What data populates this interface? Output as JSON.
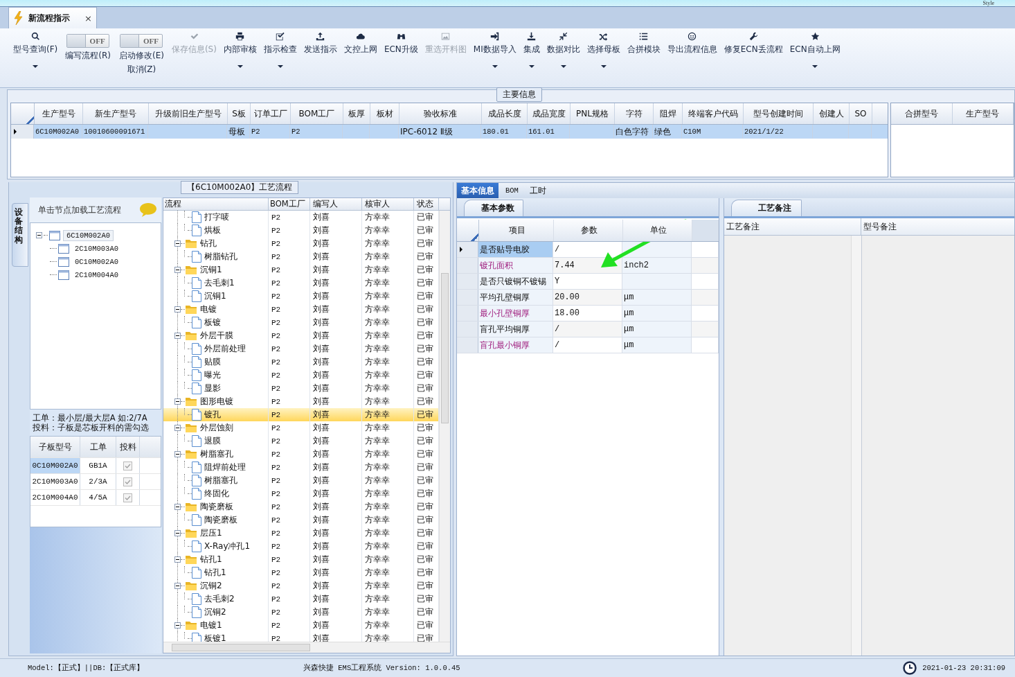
{
  "top_strip": {
    "style_menu": "Style"
  },
  "document_tab": {
    "title": "新流程指示",
    "close": "×",
    "selected": true
  },
  "toolbar": [
    {
      "kind": "button",
      "label": "型号查询(F)",
      "disabled": false,
      "dropdown": true
    },
    {
      "kind": "toggle",
      "label": "编写流程(R)",
      "switch_text": "OFF",
      "on": false
    },
    {
      "kind": "toggle",
      "label": "启动修改(E)",
      "label2": "取消(Z)",
      "switch_text": "OFF",
      "on": false
    },
    {
      "kind": "button",
      "label": "保存信息(S)",
      "disabled": true,
      "dropdown": false
    },
    {
      "kind": "button",
      "label": "内部审核",
      "disabled": false,
      "dropdown": true
    },
    {
      "kind": "button",
      "label": "指示检查",
      "disabled": false,
      "dropdown": true
    },
    {
      "kind": "button",
      "label": "发送指示",
      "disabled": false,
      "dropdown": false
    },
    {
      "kind": "button",
      "label": "文控上网",
      "disabled": false,
      "dropdown": false
    },
    {
      "kind": "button",
      "label": "ECN升级",
      "disabled": false,
      "dropdown": false
    },
    {
      "kind": "button",
      "label": "重选开料图",
      "disabled": true,
      "dropdown": false
    },
    {
      "kind": "button",
      "label": "MI数据导入",
      "disabled": false,
      "dropdown": true
    },
    {
      "kind": "button",
      "label": "集成",
      "disabled": false,
      "dropdown": true
    },
    {
      "kind": "button",
      "label": "数据对比",
      "disabled": false,
      "dropdown": true
    },
    {
      "kind": "button",
      "label": "选择母板",
      "disabled": false,
      "dropdown": true
    },
    {
      "kind": "button",
      "label": "合拼模块",
      "disabled": false,
      "dropdown": false
    },
    {
      "kind": "button",
      "label": "导出流程信息",
      "disabled": false,
      "dropdown": false
    },
    {
      "kind": "button",
      "label": "修复ECN丢流程",
      "disabled": false,
      "dropdown": false
    },
    {
      "kind": "button",
      "label": "ECN自动上网",
      "disabled": false,
      "dropdown": true
    }
  ],
  "main_info": {
    "title": "主要信息",
    "columns": [
      "生产型号",
      "新生产型号",
      "升级前旧生产型号",
      "S板",
      "订单工厂",
      "BOM工厂",
      "板厚",
      "板材",
      "验收标准",
      "成品长度",
      "成品宽度",
      "PNL规格",
      "字符",
      "阻焊",
      "终端客户代码",
      "型号创建时间",
      "创建人",
      "SO"
    ],
    "rows": [
      {
        "selected": true,
        "cells": [
          "6C10M002A0",
          "10010600091671",
          null,
          "母板",
          "P2",
          "P2",
          null,
          null,
          "IPC-6012 Ⅱ级",
          "180.01",
          "161.01",
          null,
          "白色字符",
          "绿色",
          "C10M",
          "2021/1/22",
          null,
          null
        ]
      }
    ],
    "side_columns": [
      "合拼型号",
      "生产型号"
    ]
  },
  "process": {
    "title": "【6C10M002A0】工艺流程",
    "vertical_tab": "设备结构",
    "board_tree": {
      "hint": "单击节点加载工艺流程",
      "nodes": [
        {
          "label": "6C10M002A0",
          "selected": true,
          "expanded": true,
          "children": [
            {
              "label": "2C10M003A0",
              "selected": false
            },
            {
              "label": "0C10M002A0",
              "selected": false
            },
            {
              "label": "2C10M004A0",
              "selected": false
            }
          ]
        }
      ]
    },
    "note_lines": [
      "工单：最小层/最大层A 如:2/7A",
      "投料：子板是芯板开料的需勾选"
    ],
    "sub_boards": {
      "columns": [
        "子板型号",
        "工单",
        "投料"
      ],
      "rows": [
        {
          "model": "0C10M002A0",
          "order": "GB1A",
          "feed": true,
          "selected": true
        },
        {
          "model": "2C10M003A0",
          "order": "2/3A",
          "feed": true,
          "selected": false
        },
        {
          "model": "2C10M004A0",
          "order": "4/5A",
          "feed": true,
          "selected": false
        }
      ]
    },
    "columns": [
      "流程",
      "BOM工厂",
      "编写人",
      "核审人",
      "状态"
    ],
    "nodes": [
      {
        "kind": "file",
        "name": "打字唛",
        "bom": "P2",
        "writer": "刘喜",
        "reviewer": "方幸幸",
        "status": "已审",
        "selected": false
      },
      {
        "kind": "file",
        "name": "烘板",
        "bom": "P2",
        "writer": "刘喜",
        "reviewer": "方幸幸",
        "status": "已审",
        "selected": false
      },
      {
        "kind": "folder",
        "name": "钻孔",
        "bom": "P2",
        "writer": "刘喜",
        "reviewer": "方幸幸",
        "status": "已审",
        "selected": false,
        "expanded": true,
        "children": [
          {
            "kind": "file",
            "name": "树脂钻孔",
            "bom": "P2",
            "writer": "刘喜",
            "reviewer": "方幸幸",
            "status": "已审",
            "selected": false
          }
        ]
      },
      {
        "kind": "folder",
        "name": "沉铜1",
        "bom": "P2",
        "writer": "刘喜",
        "reviewer": "方幸幸",
        "status": "已审",
        "selected": false,
        "expanded": true,
        "children": [
          {
            "kind": "file",
            "name": "去毛刺1",
            "bom": "P2",
            "writer": "刘喜",
            "reviewer": "方幸幸",
            "status": "已审",
            "selected": false
          },
          {
            "kind": "file",
            "name": "沉铜1",
            "bom": "P2",
            "writer": "刘喜",
            "reviewer": "方幸幸",
            "status": "已审",
            "selected": false
          }
        ]
      },
      {
        "kind": "folder",
        "name": "电镀",
        "bom": "P2",
        "writer": "刘喜",
        "reviewer": "方幸幸",
        "status": "已审",
        "selected": false,
        "expanded": true,
        "children": [
          {
            "kind": "file",
            "name": "板镀",
            "bom": "P2",
            "writer": "刘喜",
            "reviewer": "方幸幸",
            "status": "已审",
            "selected": false
          }
        ]
      },
      {
        "kind": "folder",
        "name": "外层干膜",
        "bom": "P2",
        "writer": "刘喜",
        "reviewer": "方幸幸",
        "status": "已审",
        "selected": false,
        "expanded": true,
        "children": [
          {
            "kind": "file",
            "name": "外层前处理",
            "bom": "P2",
            "writer": "刘喜",
            "reviewer": "方幸幸",
            "status": "已审",
            "selected": false
          },
          {
            "kind": "file",
            "name": "贴膜",
            "bom": "P2",
            "writer": "刘喜",
            "reviewer": "方幸幸",
            "status": "已审",
            "selected": false
          },
          {
            "kind": "file",
            "name": "曝光",
            "bom": "P2",
            "writer": "刘喜",
            "reviewer": "方幸幸",
            "status": "已审",
            "selected": false
          },
          {
            "kind": "file",
            "name": "显影",
            "bom": "P2",
            "writer": "刘喜",
            "reviewer": "方幸幸",
            "status": "已审",
            "selected": false
          }
        ]
      },
      {
        "kind": "folder",
        "name": "图形电镀",
        "bom": "P2",
        "writer": "刘喜",
        "reviewer": "方幸幸",
        "status": "已审",
        "selected": false,
        "expanded": true,
        "children": [
          {
            "kind": "file",
            "name": "镀孔",
            "bom": "P2",
            "writer": "刘喜",
            "reviewer": "方幸幸",
            "status": "已审",
            "selected": true
          }
        ]
      },
      {
        "kind": "folder",
        "name": "外层蚀刻",
        "bom": "P2",
        "writer": "刘喜",
        "reviewer": "方幸幸",
        "status": "已审",
        "selected": false,
        "expanded": true,
        "children": [
          {
            "kind": "file",
            "name": "退膜",
            "bom": "P2",
            "writer": "刘喜",
            "reviewer": "方幸幸",
            "status": "已审",
            "selected": false
          }
        ]
      },
      {
        "kind": "folder",
        "name": "树脂塞孔",
        "bom": "P2",
        "writer": "刘喜",
        "reviewer": "方幸幸",
        "status": "已审",
        "selected": false,
        "expanded": true,
        "children": [
          {
            "kind": "file",
            "name": "阻焊前处理",
            "bom": "P2",
            "writer": "刘喜",
            "reviewer": "方幸幸",
            "status": "已审",
            "selected": false
          },
          {
            "kind": "file",
            "name": "树脂塞孔",
            "bom": "P2",
            "writer": "刘喜",
            "reviewer": "方幸幸",
            "status": "已审",
            "selected": false
          },
          {
            "kind": "file",
            "name": "终固化",
            "bom": "P2",
            "writer": "刘喜",
            "reviewer": "方幸幸",
            "status": "已审",
            "selected": false
          }
        ]
      },
      {
        "kind": "folder",
        "name": "陶瓷磨板",
        "bom": "P2",
        "writer": "刘喜",
        "reviewer": "方幸幸",
        "status": "已审",
        "selected": false,
        "expanded": true,
        "children": [
          {
            "kind": "file",
            "name": "陶瓷磨板",
            "bom": "P2",
            "writer": "刘喜",
            "reviewer": "方幸幸",
            "status": "已审",
            "selected": false
          }
        ]
      },
      {
        "kind": "folder",
        "name": "层压1",
        "bom": "P2",
        "writer": "刘喜",
        "reviewer": "方幸幸",
        "status": "已审",
        "selected": false,
        "expanded": true,
        "children": [
          {
            "kind": "file",
            "name": "X-Ray冲孔1",
            "bom": "P2",
            "writer": "刘喜",
            "reviewer": "方幸幸",
            "status": "已审",
            "selected": false
          }
        ]
      },
      {
        "kind": "folder",
        "name": "钻孔1",
        "bom": "P2",
        "writer": "刘喜",
        "reviewer": "方幸幸",
        "status": "已审",
        "selected": false,
        "expanded": true,
        "children": [
          {
            "kind": "file",
            "name": "钻孔1",
            "bom": "P2",
            "writer": "刘喜",
            "reviewer": "方幸幸",
            "status": "已审",
            "selected": false
          }
        ]
      },
      {
        "kind": "folder",
        "name": "沉铜2",
        "bom": "P2",
        "writer": "刘喜",
        "reviewer": "方幸幸",
        "status": "已审",
        "selected": false,
        "expanded": true,
        "children": [
          {
            "kind": "file",
            "name": "去毛刺2",
            "bom": "P2",
            "writer": "刘喜",
            "reviewer": "方幸幸",
            "status": "已审",
            "selected": false
          },
          {
            "kind": "file",
            "name": "沉铜2",
            "bom": "P2",
            "writer": "刘喜",
            "reviewer": "方幸幸",
            "status": "已审",
            "selected": false
          }
        ]
      },
      {
        "kind": "folder",
        "name": "电镀1",
        "bom": "P2",
        "writer": "刘喜",
        "reviewer": "方幸幸",
        "status": "已审",
        "selected": false,
        "expanded": true,
        "children": [
          {
            "kind": "file",
            "name": "板镀1",
            "bom": "P2",
            "writer": "刘喜",
            "reviewer": "方幸幸",
            "status": "已审",
            "selected": false
          }
        ]
      }
    ]
  },
  "detail": {
    "tabs": [
      {
        "label": "基本信息",
        "selected": true
      },
      {
        "label": "BOM",
        "selected": false
      },
      {
        "label": "工时",
        "selected": false
      }
    ],
    "param_tab": "基本参数",
    "param_columns": [
      "项目",
      "参数",
      "单位"
    ],
    "params": [
      {
        "name": "是否贴导电胶",
        "value": "/",
        "highlighted": false,
        "selected": true
      },
      {
        "name": "镀孔面积",
        "value": "7.44",
        "unit": "inch2",
        "highlighted": true,
        "selected": false
      },
      {
        "name": "是否只镀铜不镀锡",
        "value": "Y",
        "highlighted": false,
        "selected": false
      },
      {
        "name": "平均孔壁铜厚",
        "value": "20.00",
        "unit": "μm",
        "highlighted": false,
        "selected": false
      },
      {
        "name": "最小孔壁铜厚",
        "value": "18.00",
        "unit": "μm",
        "highlighted": true,
        "selected": false
      },
      {
        "name": "盲孔平均铜厚",
        "value": "/",
        "unit": "μm",
        "highlighted": false,
        "selected": false
      },
      {
        "name": "盲孔最小铜厚",
        "value": "/",
        "unit": "μm",
        "highlighted": true,
        "selected": false
      }
    ],
    "notes_tab": "工艺备注",
    "note_columns": [
      "工艺备注",
      "型号备注"
    ]
  },
  "status_bar": {
    "left": "Model:【正式】||DB:【正式库】",
    "center": "兴森快捷 EMS工程系统 Version: 1.0.0.45",
    "time": "2021-01-23 20:31:09"
  }
}
